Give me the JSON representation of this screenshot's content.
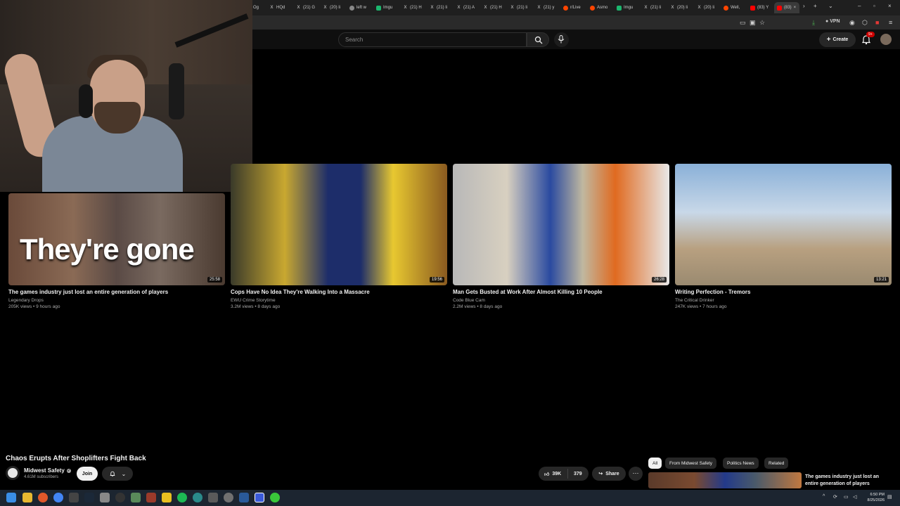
{
  "browser": {
    "tabs": [
      "Og",
      "HQd",
      "(21) G",
      "(20) li",
      "left w",
      "Imgu",
      "(21) H",
      "(21) li",
      "(21) A",
      "(21) H",
      "(21) li",
      "(21) y",
      "r/Live",
      "Asmo",
      "Imgu",
      "(21) li",
      "(20) li",
      "(20) li",
      "Well,",
      "(83) Y",
      "(83)"
    ],
    "new_tab": "+",
    "vpn_label": "VPN"
  },
  "youtube": {
    "search_placeholder": "Search",
    "create_label": "Create",
    "notifications_badge": "9+"
  },
  "videos": [
    {
      "title": "The games industry just lost an entire generation of players",
      "channel": "Legendary Drops",
      "meta": "205K views • 9 hours ago",
      "duration": "25:58",
      "thumb_text": "They're gone"
    },
    {
      "title": "Cops Have No Idea They're Walking Into a Massacre",
      "channel": "EWU Crime Storytime",
      "meta": "3.2M views • 8 days ago",
      "duration": "19:56"
    },
    {
      "title": "Man Gets Busted at Work After Almost Killing 10 People",
      "channel": "Code Blue Cam",
      "meta": "2.2M views • 8 days ago",
      "duration": "26:28"
    },
    {
      "title": "Writing Perfection - Tremors",
      "channel": "The Critical Drinker",
      "meta": "247K views • 7 hours ago",
      "duration": "13:21"
    }
  ],
  "watch": {
    "title": "Chaos Erupts After Shoplifters Fight Back",
    "channel": "Midwest Safety",
    "subscribers": "4.61M subscribers",
    "join_label": "Join",
    "likes": "39K",
    "dislikes": "379",
    "share_label": "Share",
    "more_label": "⋯"
  },
  "chips": [
    "All",
    "From Midwest Safety",
    "Politics News",
    "Related"
  ],
  "recommended": {
    "title": "The games industry just lost an entire generation of players"
  },
  "taskbar": {
    "time": "6:50 PM",
    "date": "8/25/2026"
  },
  "colors": {
    "accent_red": "#cc0000",
    "background": "#000000"
  }
}
